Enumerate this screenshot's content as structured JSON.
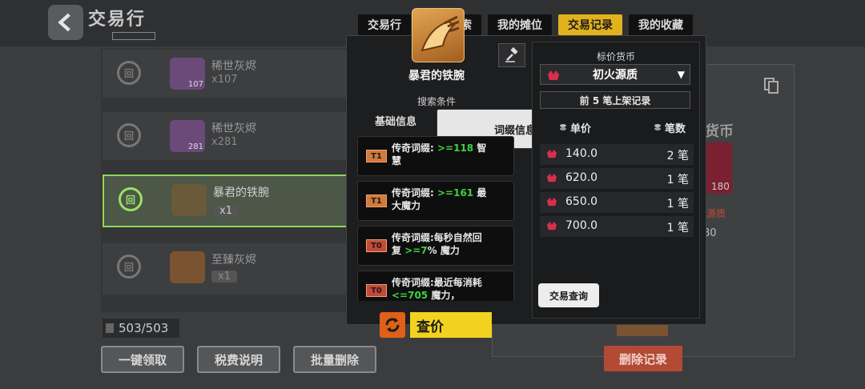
{
  "header": {
    "title": "交易行"
  },
  "tabs": [
    {
      "label": "交易行"
    },
    {
      "label": "精确搜索"
    },
    {
      "label": "我的摊位"
    },
    {
      "label": "交易记录",
      "active": true
    },
    {
      "label": "我的收藏"
    }
  ],
  "list": {
    "rows": [
      {
        "name": "稀世灰烬",
        "qty": "x107",
        "thumb_count": "107"
      },
      {
        "name": "稀世灰烬",
        "qty": "x281",
        "thumb_count": "281"
      },
      {
        "name": "暴君的铁腕",
        "qty": "x1",
        "selected": true
      },
      {
        "name": "至臻灰烬",
        "qty": "x1"
      }
    ],
    "count": "503/503"
  },
  "bottom_buttons": {
    "claim_all": "一键领取",
    "tax_info": "税费说明",
    "batch_delete": "批量删除"
  },
  "background_right": {
    "currency": "货币",
    "crystal_count": "180",
    "source": "源质",
    "amount": "80",
    "delete_record": "删除记录"
  },
  "popup": {
    "item_name": "暴君的铁腕",
    "search_conditions": "搜索条件",
    "subtabs": {
      "basic": "基础信息",
      "affix": "词缀信息"
    },
    "affixes": [
      {
        "tier": "T1",
        "prefix": "传奇词缀: ",
        "value": ">=118",
        "suffix": " 智慧",
        "checked": false
      },
      {
        "tier": "T1",
        "prefix": "传奇词缀: ",
        "value": ">=161",
        "suffix": " 最大魔力",
        "checked": false
      },
      {
        "tier": "T0",
        "prefix": "传奇词缀:每秒自然回复 ",
        "value": ">=7",
        "suffix": "% 魔力",
        "checked": true
      },
      {
        "tier": "T0",
        "prefix": "传奇词缀:最近每消耗 ",
        "value": "<=705",
        "suffix": " 魔力，",
        "checked": true
      }
    ],
    "price_button": "查价",
    "currency_label": "标价货币",
    "currency_selected": "初火源质",
    "recent_records": "前 5 笔上架记录",
    "columns": {
      "unit_price": "单价",
      "count": "笔数"
    },
    "records": [
      {
        "price": "140.0",
        "count": "2 笔"
      },
      {
        "price": "620.0",
        "count": "1 笔"
      },
      {
        "price": "650.0",
        "count": "1 笔"
      },
      {
        "price": "700.0",
        "count": "1 笔"
      }
    ],
    "trade_query": "交易查询"
  },
  "colors": {
    "accent_yellow": "#f2d21e",
    "tab_active": "#e2b21d",
    "success_green": "#3fd13f",
    "danger": "#b24a36",
    "tier_orange": "#d17a3a"
  }
}
